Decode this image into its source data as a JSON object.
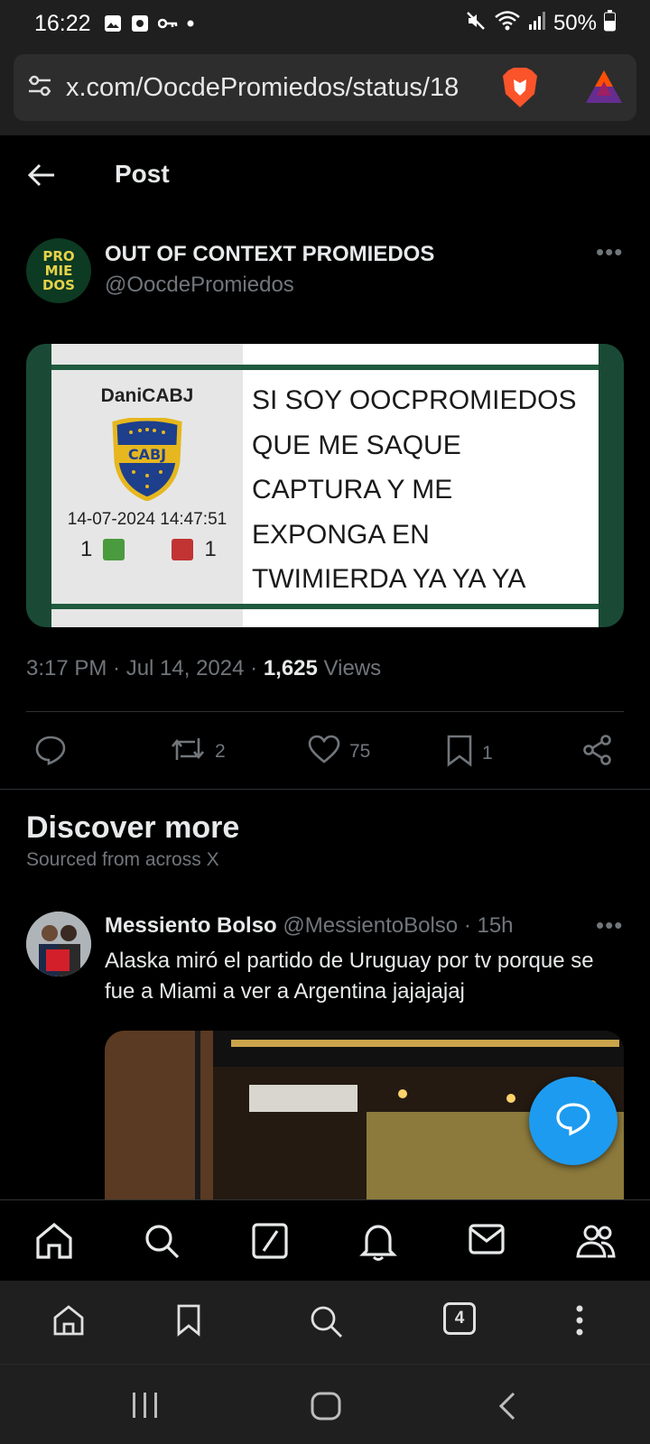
{
  "status_bar": {
    "time": "16:22",
    "battery": "50%"
  },
  "browser": {
    "url": "x.com/OocdePromiedos/status/18",
    "tab_count": "4"
  },
  "header": {
    "title": "Post"
  },
  "post": {
    "author_name": "OUT OF CONTEXT PROMIEDOS",
    "author_handle": "@OocdePromiedos",
    "avatar_lines": [
      "PRO",
      "MIE",
      "DOS"
    ],
    "image": {
      "username": "DaniCABJ",
      "badge_text": "CABJ",
      "timestamp": "14-07-2024 14:47:51",
      "likes": "1",
      "dislikes": "1",
      "meme_lines": [
        "SI SOY OOCPROMIEDOS",
        "QUE ME SAQUE",
        "CAPTURA Y ME",
        "EXPONGA EN",
        "TWIMIERDA YA YA YA"
      ]
    },
    "time": "3:17 PM · Jul 14, 2024 ·",
    "views_count": "1,625",
    "views_label": "Views",
    "reposts": "2",
    "likes": "75",
    "bookmarks": "1"
  },
  "discover": {
    "title": "Discover more",
    "subtitle": "Sourced from across X"
  },
  "tweet2": {
    "name": "Messiento Bolso",
    "handle": "@MessientoBolso",
    "age": "· 15h",
    "text": "Alaska miró el partido de Uruguay por tv porque se fue a Miami a ver a Argentina jajajajaj"
  },
  "colors": {
    "accent": "#1d9bf0",
    "background": "#000000",
    "secondary_text": "#71767b",
    "divider": "#2f3336"
  }
}
